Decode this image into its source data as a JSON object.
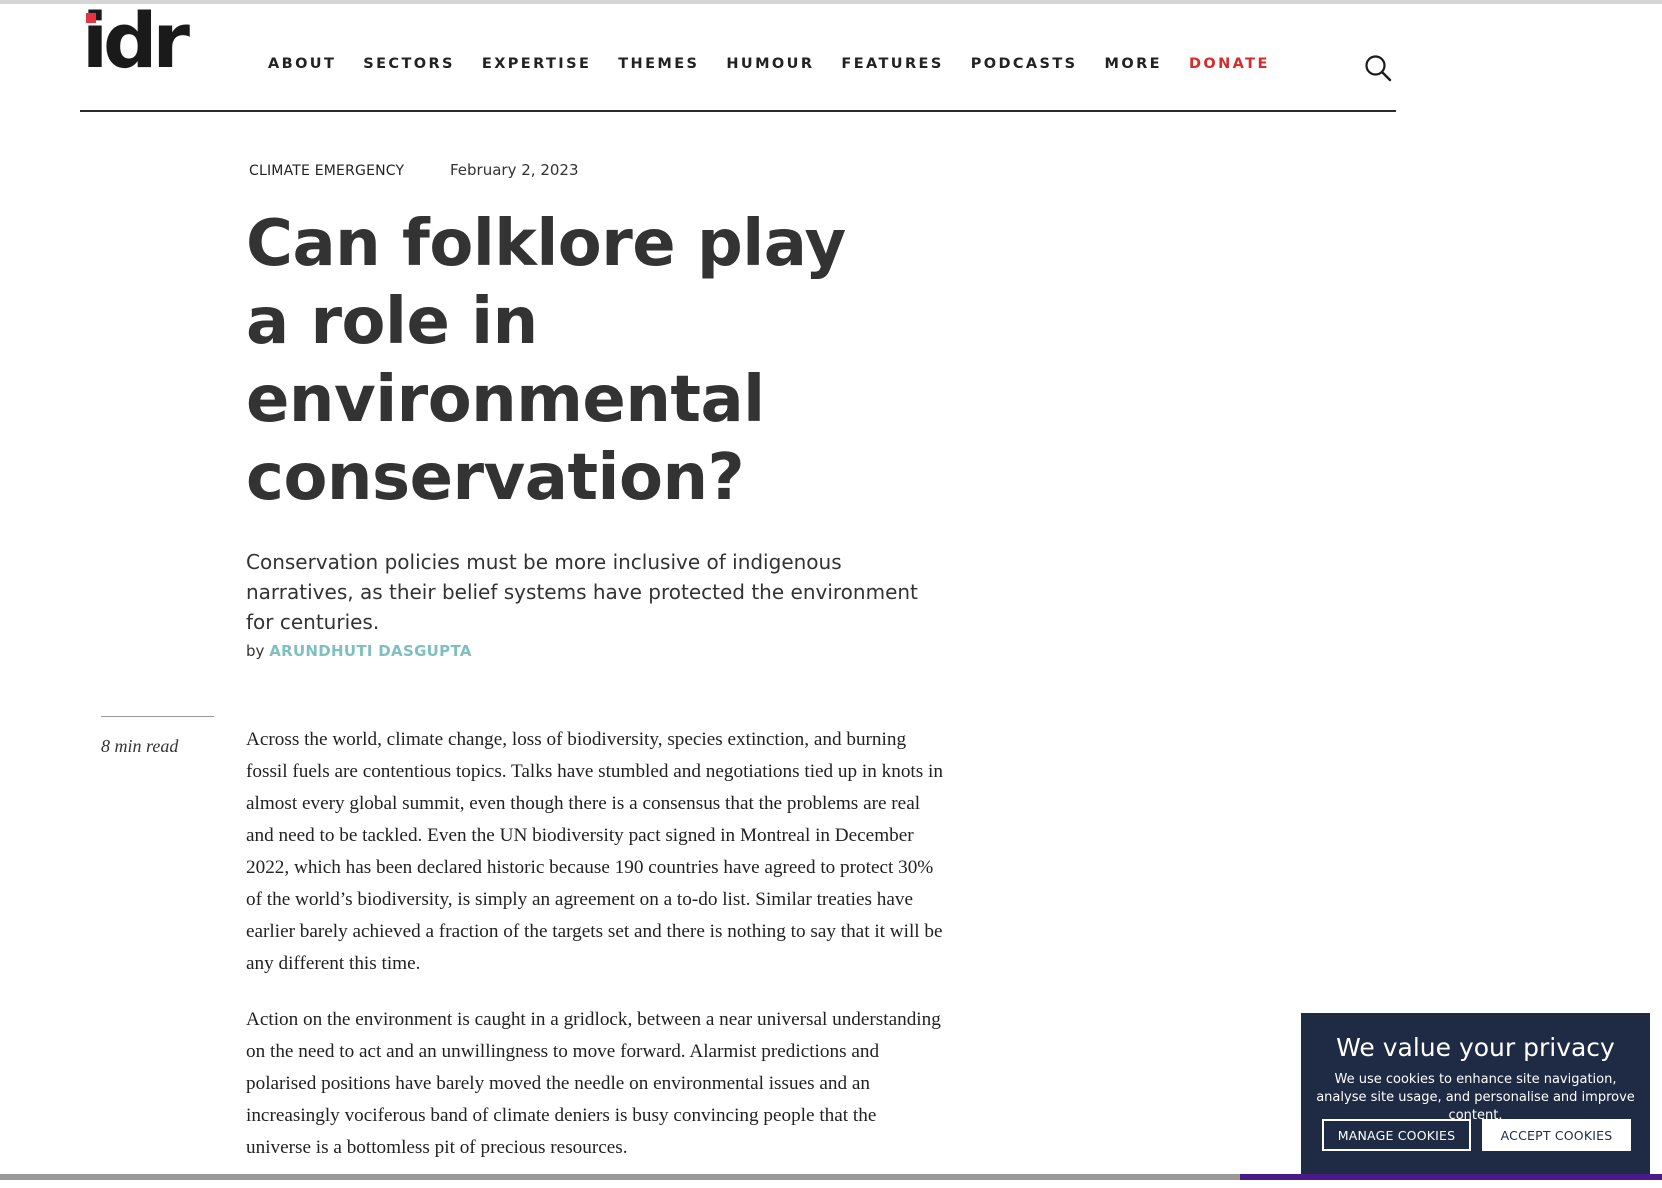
{
  "header": {
    "logo_text": "idr",
    "nav": [
      "ABOUT",
      "SECTORS",
      "EXPERTISE",
      "THEMES",
      "HUMOUR",
      "FEATURES",
      "PODCASTS",
      "MORE"
    ],
    "donate": "DONATE",
    "search_icon": "search-icon"
  },
  "article": {
    "category": "CLIMATE EMERGENCY",
    "date": "February 2, 2023",
    "title": "Can folklore play a role in environmental conservation?",
    "dek": "Conservation policies must be more inclusive of indigenous narratives, as their belief systems have protected the environment for centuries.",
    "by": "by",
    "author": "ARUNDHUTI DASGUPTA",
    "read_time": "8 min read",
    "paragraphs": [
      "Across the world, climate change, loss of biodiversity, species extinction, and burning fossil fuels are contentious topics. Talks have stumbled and negotiations tied up in knots in almost every global summit, even though there is a consensus that the problems are real and need to be tackled. Even the UN biodiversity pact signed in Montreal in December 2022, which has been declared historic because 190 countries have agreed to protect 30% of the world’s biodiversity, is simply an agreement on a to-do list. Similar treaties have earlier barely achieved a fraction of the targets set and there is nothing to say that it will be any different this time.",
      "Action on the environment is caught in a gridlock, between a near universal understanding on the need to act and an unwillingness to move forward. Alarmist predictions and polarised positions have barely moved the needle on environmental issues and an increasingly vociferous band of climate deniers is busy convincing people that the universe is a bottomless pit of precious resources."
    ]
  },
  "cookie": {
    "title": "We value your privacy",
    "description": "We use cookies to enhance site navigation, analyse site usage, and personalise and improve content.",
    "manage": "MANAGE COOKIES",
    "accept": "ACCEPT COOKIES"
  },
  "colors": {
    "accent_red": "#d92a2a",
    "author_teal": "#7fbfbf",
    "cookie_bg": "#1f2a44"
  }
}
